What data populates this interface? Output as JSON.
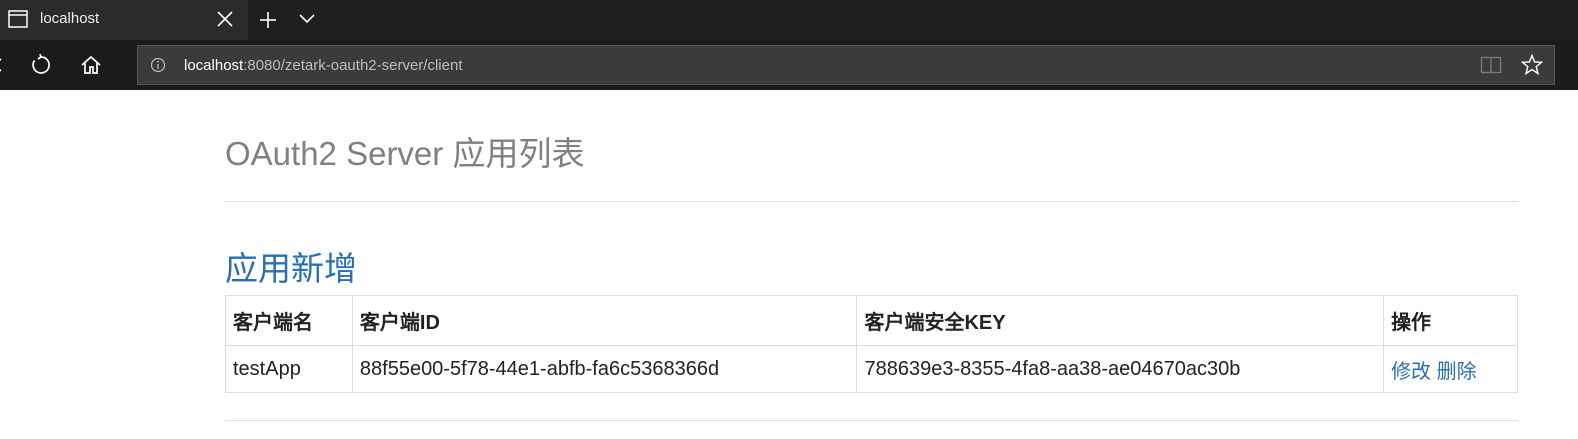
{
  "browser": {
    "tab_title": "localhost",
    "url_host": "localhost",
    "url_rest": ":8080/zetark-oauth2-server/client"
  },
  "page": {
    "title": "OAuth2 Server 应用列表",
    "add_link": "应用新增",
    "table": {
      "headers": [
        "客户端名",
        "客户端ID",
        "客户端安全KEY",
        "操作"
      ],
      "rows": [
        {
          "name": "testApp",
          "client_id": "88f55e00-5f78-44e1-abfb-fa6c5368366d",
          "client_secret": "788639e3-8355-4fa8-aa38-ae04670ac30b",
          "edit": "修改",
          "delete": "删除"
        }
      ]
    }
  },
  "icons": [
    "tab-page-icon",
    "close-icon",
    "plus-icon",
    "chevron-down-icon",
    "back-icon",
    "refresh-icon",
    "home-icon",
    "info-icon",
    "reading-view-icon",
    "star-icon"
  ],
  "colors": {
    "link": "#2a6fb1",
    "title": "#808080"
  }
}
